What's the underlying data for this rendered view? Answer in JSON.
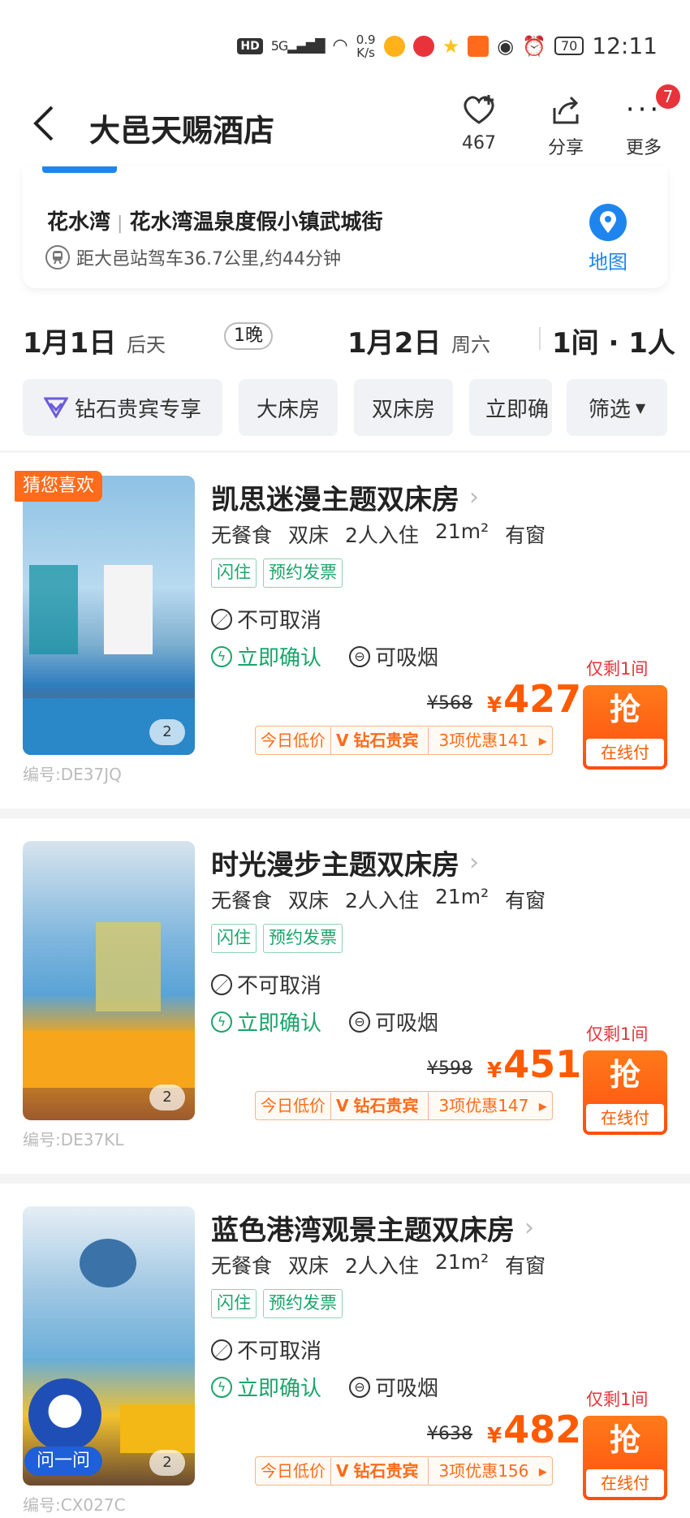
{
  "status_bar": {
    "hd": "HD",
    "network": "5G",
    "speed_value": "0.9",
    "speed_unit": "K/s",
    "battery": "70",
    "time": "12:11"
  },
  "header": {
    "back_icon": "back-arrow-icon",
    "title": "大邑天赐酒店",
    "favorite_count": "467",
    "share_label": "分享",
    "more_label": "更多",
    "more_badge": "7"
  },
  "address": {
    "area": "花水湾",
    "street": "花水湾温泉度假小镇武城街",
    "distance": "距大邑站驾车36.7公里,约44分钟",
    "map_label": "地图"
  },
  "stay": {
    "checkin_date": "1月1日",
    "checkin_day": "后天",
    "nights": "1晚",
    "checkout_date": "1月2日",
    "checkout_day": "周六",
    "rooms_guests": "1间 · 1人"
  },
  "filters": {
    "diamond": "钻石贵宾专享",
    "king": "大床房",
    "twin": "双床房",
    "instant": "立即确",
    "filter": "筛选"
  },
  "common": {
    "guess_you_like": "猜您喜欢",
    "tag_flash": "闪住",
    "tag_invoice": "预约发票",
    "no_cancel": "不可取消",
    "instant_confirm": "立即确认",
    "smoking": "可吸烟",
    "promo_today": "今日低价",
    "promo_diamond": "钻石贵宾",
    "left": "仅剩1间",
    "grab": "抢",
    "online_pay": "在线付",
    "yen": "¥",
    "assistant": "问一问",
    "accent_color": "#ff5a00",
    "green_color": "#1aa56a"
  },
  "rooms": [
    {
      "name": "凯思迷漫主题双床房",
      "specs": [
        "无餐食",
        "双床",
        "2人入住",
        "21m²",
        "有窗"
      ],
      "original_price": "¥568",
      "price": "427",
      "promo": "3项优惠141",
      "image_count": "2",
      "code": "编号:DE37JQ"
    },
    {
      "name": "时光漫步主题双床房",
      "specs": [
        "无餐食",
        "双床",
        "2人入住",
        "21m²",
        "有窗"
      ],
      "original_price": "¥598",
      "price": "451",
      "promo": "3项优惠147",
      "image_count": "2",
      "code": "编号:DE37KL"
    },
    {
      "name": "蓝色港湾观景主题双床房",
      "specs": [
        "无餐食",
        "双床",
        "2人入住",
        "21m²",
        "有窗"
      ],
      "original_price": "¥638",
      "price": "482",
      "promo": "3项优惠156",
      "image_count": "2",
      "code": "编号:CX027C"
    }
  ]
}
